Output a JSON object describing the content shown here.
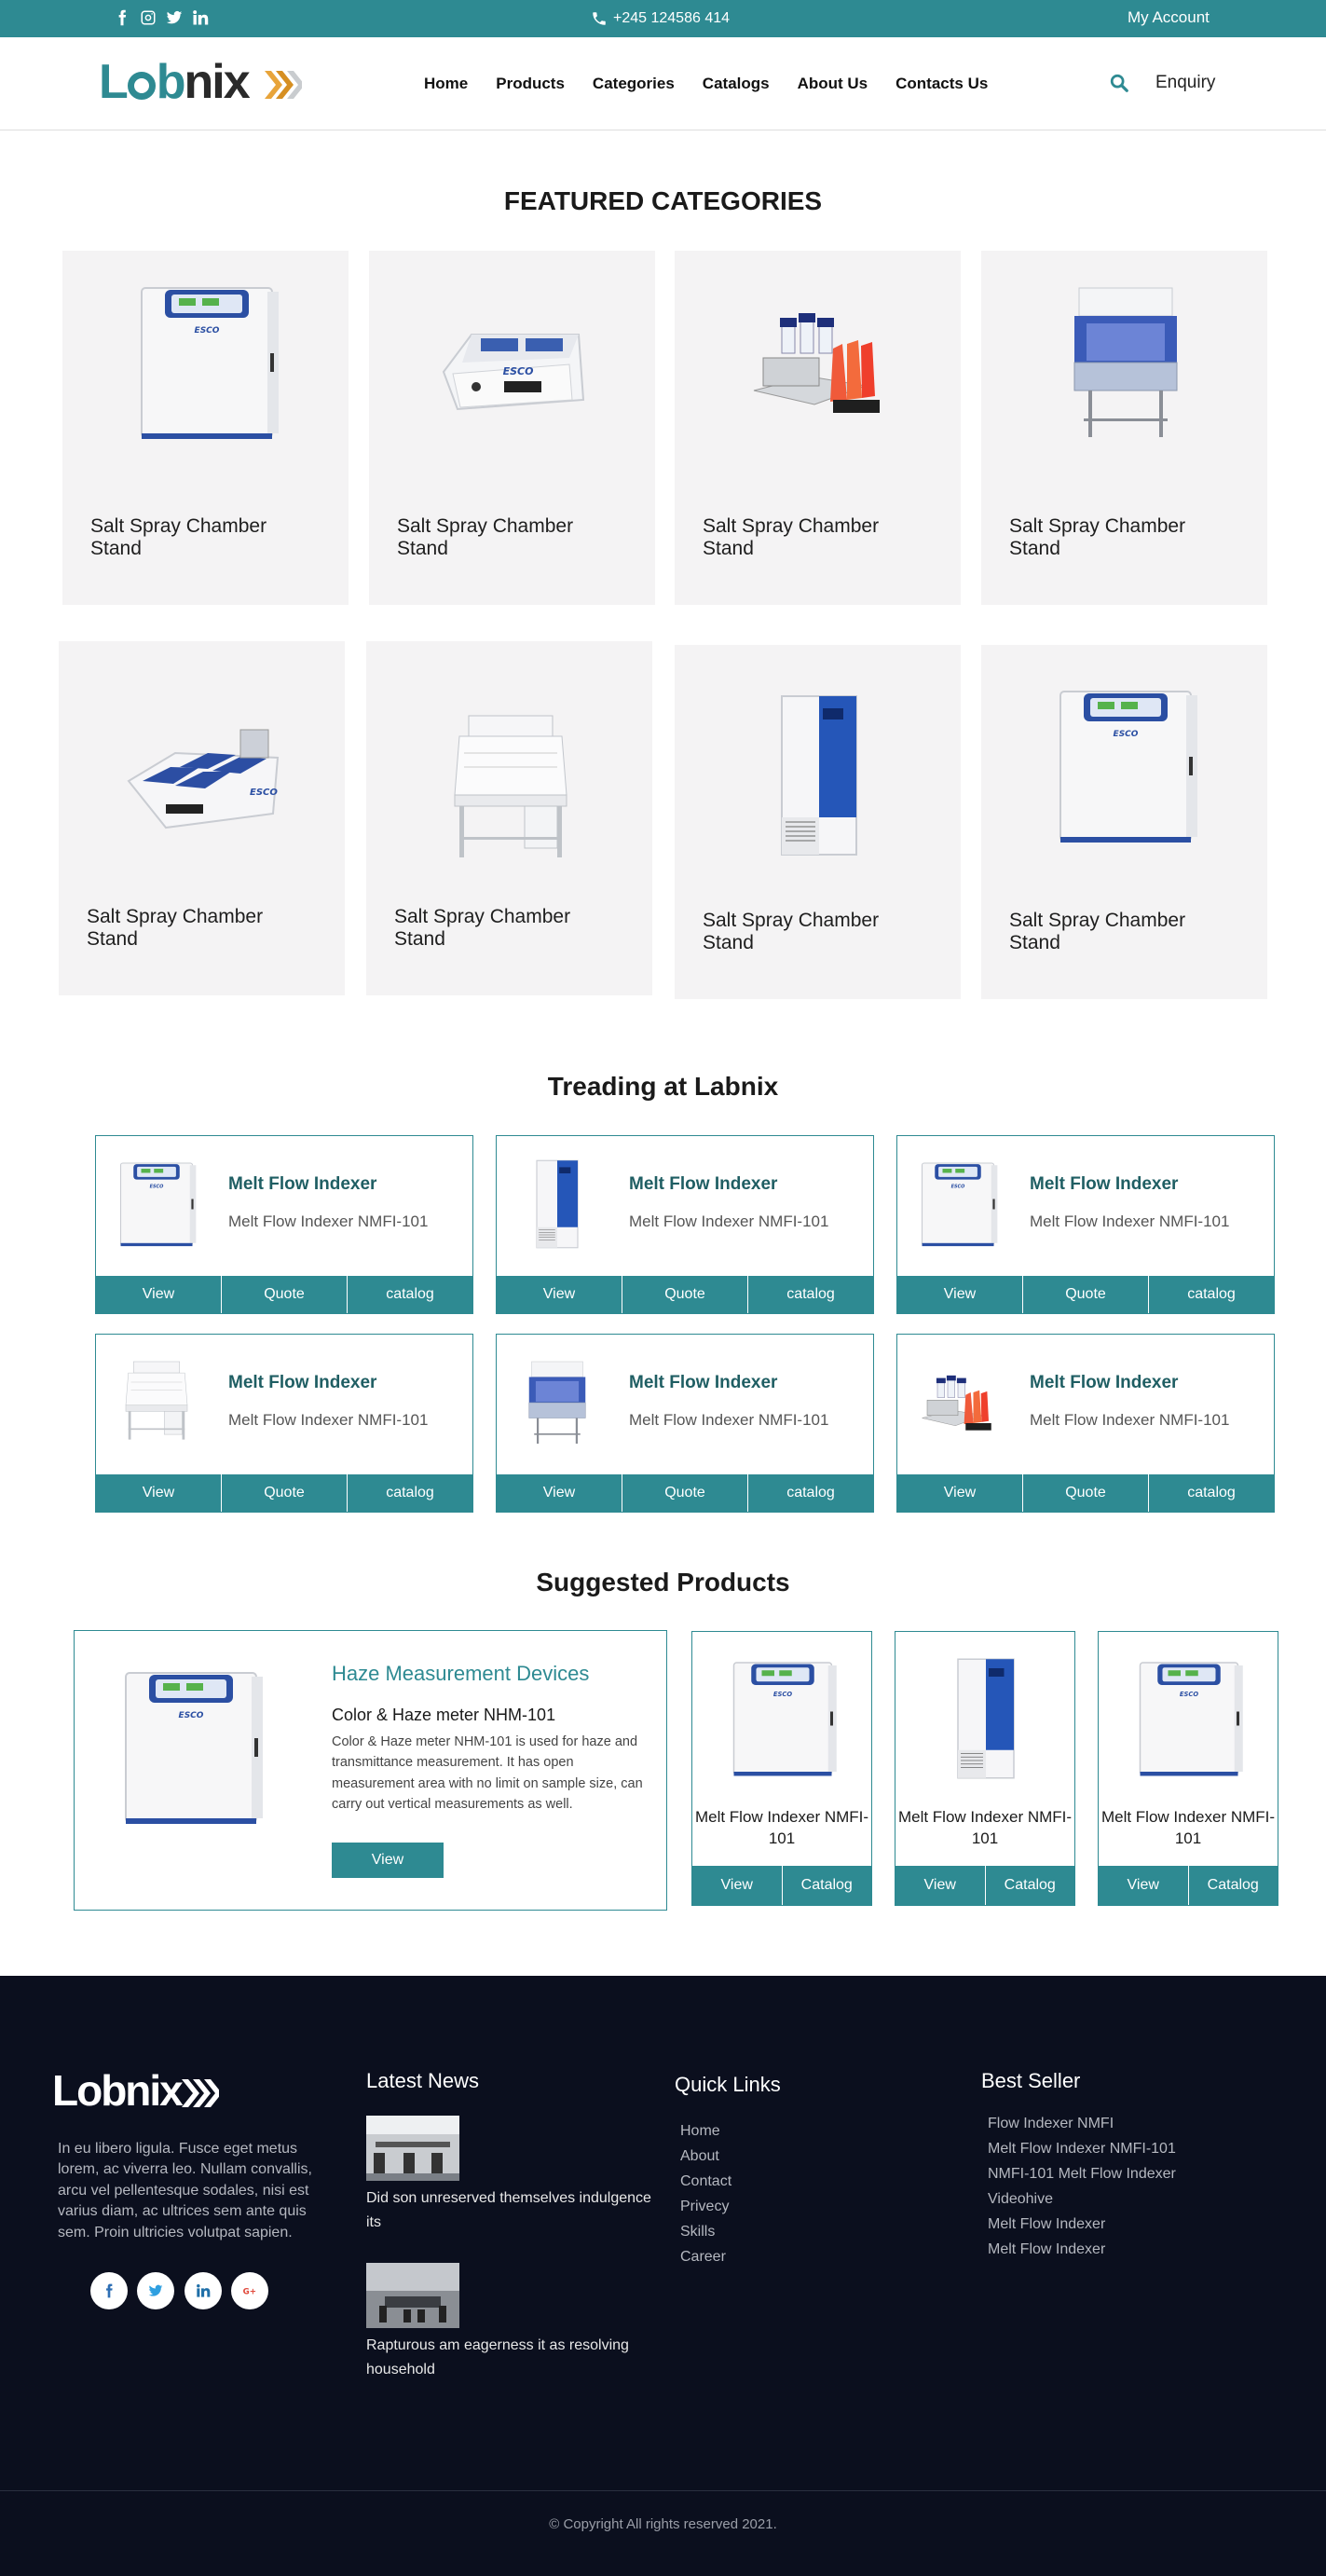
{
  "topbar": {
    "phone": "+245 124586 414",
    "account": "My Account"
  },
  "header": {
    "logo_a": "L",
    "logo_b": "b",
    "logo_c": "nix",
    "nav": [
      "Home",
      "Products",
      "Categories",
      "Catalogs",
      "About Us",
      "Contacts Us"
    ],
    "enquiry": "Enquiry"
  },
  "featured": {
    "title": "FEATURED CATEGORIES",
    "items": [
      {
        "name": "Salt Spray Chamber Stand",
        "icon": "incubator"
      },
      {
        "name": "Salt Spray Chamber Stand",
        "icon": "water-bath"
      },
      {
        "name": "Salt Spray Chamber Stand",
        "icon": "bottle-dispenser"
      },
      {
        "name": "Salt Spray Chamber Stand",
        "icon": "biosafety-cabinet"
      },
      {
        "name": "Salt Spray Chamber Stand",
        "icon": "multi-bath"
      },
      {
        "name": "Salt Spray Chamber Stand",
        "icon": "fume-hood"
      },
      {
        "name": "Salt Spray Chamber Stand",
        "icon": "freezer"
      },
      {
        "name": "Salt Spray Chamber Stand",
        "icon": "incubator"
      }
    ]
  },
  "trending": {
    "title": "Treading at Labnix",
    "items": [
      {
        "title": "Melt Flow Indexer",
        "sub": "Melt Flow Indexer NMFI-101",
        "icon": "incubator"
      },
      {
        "title": "Melt Flow Indexer",
        "sub": "Melt Flow Indexer NMFI-101",
        "icon": "freezer"
      },
      {
        "title": "Melt Flow Indexer",
        "sub": "Melt Flow Indexer NMFI-101",
        "icon": "incubator"
      },
      {
        "title": "Melt Flow Indexer",
        "sub": "Melt Flow Indexer NMFI-101",
        "icon": "fume-hood"
      },
      {
        "title": "Melt Flow Indexer",
        "sub": "Melt Flow Indexer NMFI-101",
        "icon": "biosafety-cabinet"
      },
      {
        "title": "Melt Flow Indexer",
        "sub": "Melt Flow Indexer NMFI-101",
        "icon": "bottle-dispenser"
      }
    ],
    "buttons": [
      "View",
      "Quote",
      "catalog"
    ]
  },
  "suggested": {
    "title": "Suggested Products",
    "big": {
      "heading": "Haze Measurement Devices",
      "subheading": "Color & Haze meter NHM-101",
      "desc": "Color & Haze meter NHM-101 is used for haze and transmittance measurement. It has open measurement area with no limit on sample size, can carry out vertical measurements as well.",
      "button": "View"
    },
    "items": [
      {
        "name": "Melt Flow Indexer NMFI-101",
        "icon": "incubator"
      },
      {
        "name": "Melt Flow Indexer NMFI-101",
        "icon": "freezer"
      },
      {
        "name": "Melt Flow Indexer NMFI-101",
        "icon": "incubator"
      }
    ],
    "buttons": [
      "View",
      "Catalog"
    ]
  },
  "footer": {
    "logo": "Lobnix",
    "about": "In eu libero ligula. Fusce eget metus lorem, ac viverra leo. Nullam convallis, arcu vel pellentesque sodales, nisi est varius diam, ac ultrices sem ante quis sem. Proin ultricies volutpat sapien.",
    "news_title": "Latest News",
    "news": [
      "Did son unreserved themselves indulgence its",
      "Rapturous am eagerness it as resolving household"
    ],
    "links_title": "Quick Links",
    "links": [
      "Home",
      "About",
      "Contact",
      "Privecy",
      "Skills",
      "Career"
    ],
    "best_title": "Best Seller",
    "best": [
      "Flow Indexer NMFI",
      "Melt Flow Indexer NMFI-101",
      "NMFI-101 Melt Flow Indexer",
      "Videohive",
      "Melt Flow Indexer",
      "Melt Flow Indexer"
    ],
    "copyright": "© Copyright All rights reserved 2021."
  },
  "colors": {
    "accent": "#2e8a92",
    "footer_bg": "#0b0f1e",
    "card_bg": "#f4f3f4"
  }
}
